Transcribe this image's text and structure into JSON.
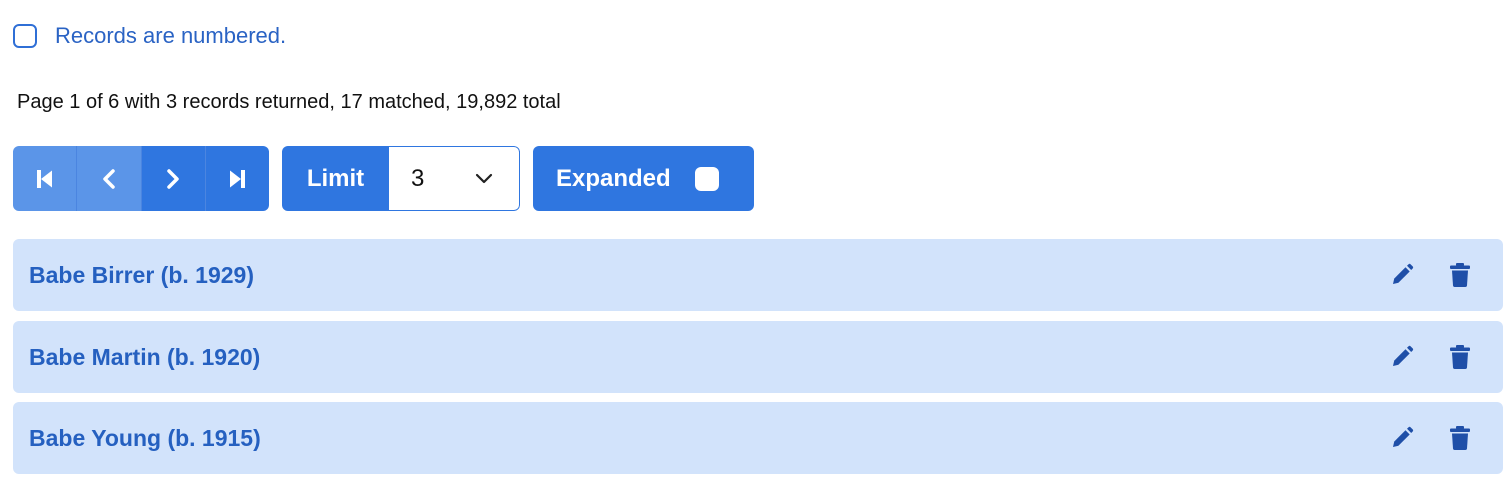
{
  "numbering": {
    "label": "Records are numbered.",
    "checked": false
  },
  "summary": "Page 1 of 6 with 3 records returned, 17 matched, 19,892 total",
  "pager": {
    "buttons": [
      {
        "icon": "first-page-icon",
        "disabled": true
      },
      {
        "icon": "chevron-left-icon",
        "disabled": true
      },
      {
        "icon": "chevron-right-icon",
        "disabled": false
      },
      {
        "icon": "last-page-icon",
        "disabled": false
      }
    ]
  },
  "limit": {
    "label": "Limit",
    "value": "3"
  },
  "expanded": {
    "label": "Expanded",
    "checked": false
  },
  "records": [
    {
      "name": "Babe Birrer (b. 1929)"
    },
    {
      "name": "Babe Martin (b. 1920)"
    },
    {
      "name": "Babe Young (b. 1915)"
    }
  ],
  "colors": {
    "primary": "#2f76e0",
    "primary_disabled": "#5b95e8",
    "row_background": "#d2e3fb",
    "link_text": "#2560c0",
    "icon": "#1f4fa8"
  }
}
